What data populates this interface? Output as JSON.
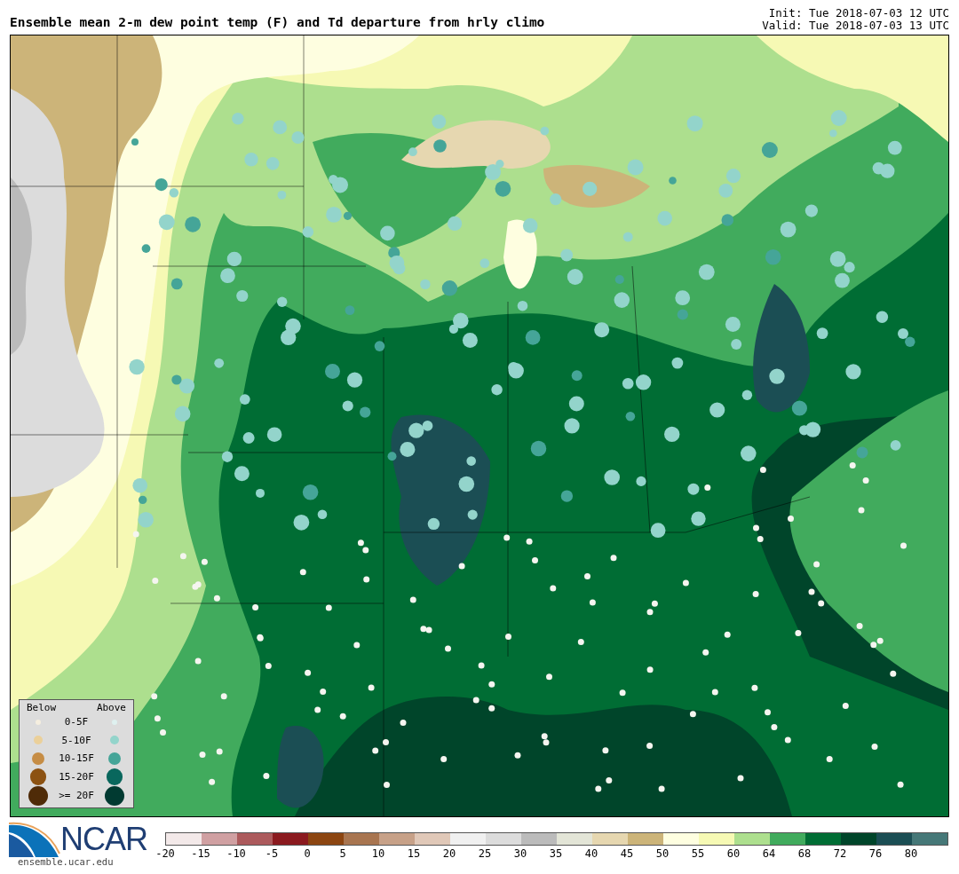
{
  "title": "Ensemble mean 2-m dew point temp (F) and Td departure from hrly climo",
  "init": "Init: Tue 2018-07-03 12 UTC",
  "valid": "Valid: Tue 2018-07-03 13 UTC",
  "legend": {
    "below_label": "Below",
    "above_label": "Above",
    "rows": [
      {
        "label": "0-5F",
        "dots": [
          {
            "color": "#f5eedf"
          },
          {
            "color": "#dff1f0"
          }
        ]
      },
      {
        "label": "5-10F",
        "dots": [
          {
            "color": "#ebd09a"
          },
          {
            "color": "#93d4cb"
          }
        ]
      },
      {
        "label": "10-15F",
        "dots": [
          {
            "color": "#c68d45"
          },
          {
            "color": "#45a598"
          }
        ]
      },
      {
        "label": "15-20F",
        "dots": [
          {
            "color": "#8c5212"
          },
          {
            "color": "#09675d"
          }
        ]
      },
      {
        "label": ">= 20F",
        "dots": [
          {
            "color": "#4f2b08"
          },
          {
            "color": "#013a31"
          }
        ]
      }
    ]
  },
  "colorbar": {
    "bins": [
      {
        "color": "#f3e9e9"
      },
      {
        "color": "#d0a0a2"
      },
      {
        "color": "#ac5a5c"
      },
      {
        "color": "#8b1a1f"
      },
      {
        "color": "#8c4511"
      },
      {
        "color": "#a87550"
      },
      {
        "color": "#c7a188"
      },
      {
        "color": "#e0c8b8"
      },
      {
        "color": "#f0f0f0"
      },
      {
        "color": "#dcdcdc"
      },
      {
        "color": "#bbbbbb"
      },
      {
        "color": "#e3e5d7"
      },
      {
        "color": "#e6d7b0"
      },
      {
        "color": "#ccb479"
      },
      {
        "color": "#fefee0"
      },
      {
        "color": "#f6f9b4"
      },
      {
        "color": "#addf8e"
      },
      {
        "color": "#41ab5d"
      },
      {
        "color": "#006d34"
      },
      {
        "color": "#00452a"
      },
      {
        "color": "#1b4e54"
      },
      {
        "color": "#467878"
      }
    ],
    "ticks": [
      "-20",
      "-15",
      "-10",
      "-5",
      "0",
      "5",
      "10",
      "15",
      "20",
      "25",
      "30",
      "35",
      "40",
      "45",
      "50",
      "55",
      "60",
      "64",
      "68",
      "72",
      "76",
      "80"
    ]
  },
  "logo": {
    "text": "NCAR",
    "url": "ensemble.ucar.edu"
  }
}
